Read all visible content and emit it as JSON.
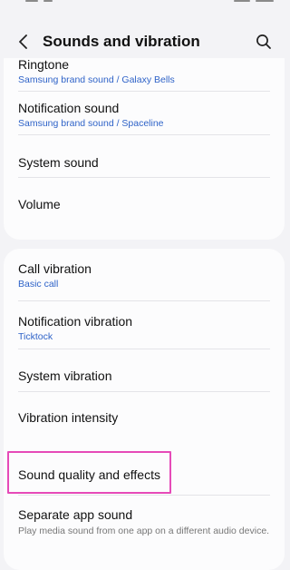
{
  "header": {
    "title": "Sounds and vibration"
  },
  "group1": {
    "ringtone": {
      "label": "Ringtone",
      "value": "Samsung brand sound / Galaxy Bells"
    },
    "notification_sound": {
      "label": "Notification sound",
      "value": "Samsung brand sound / Spaceline"
    },
    "system_sound": {
      "label": "System sound"
    },
    "volume": {
      "label": "Volume"
    }
  },
  "group2": {
    "call_vibration": {
      "label": "Call vibration",
      "value": "Basic call"
    },
    "notification_vibration": {
      "label": "Notification vibration",
      "value": "Ticktock"
    },
    "system_vibration": {
      "label": "System vibration"
    },
    "vibration_intensity": {
      "label": "Vibration intensity"
    }
  },
  "group3": {
    "sound_quality": {
      "label": "Sound quality and effects"
    },
    "separate_app_sound": {
      "label": "Separate app sound",
      "description": "Play media sound from one app on a different audio device."
    }
  },
  "colors": {
    "accent_blue": "#2f63c8",
    "highlight_pink": "#e64ab8",
    "background": "#f3f3f6",
    "card": "#fcfcfd"
  },
  "icons": {
    "back": "chevron-left-icon",
    "search": "search-icon"
  }
}
